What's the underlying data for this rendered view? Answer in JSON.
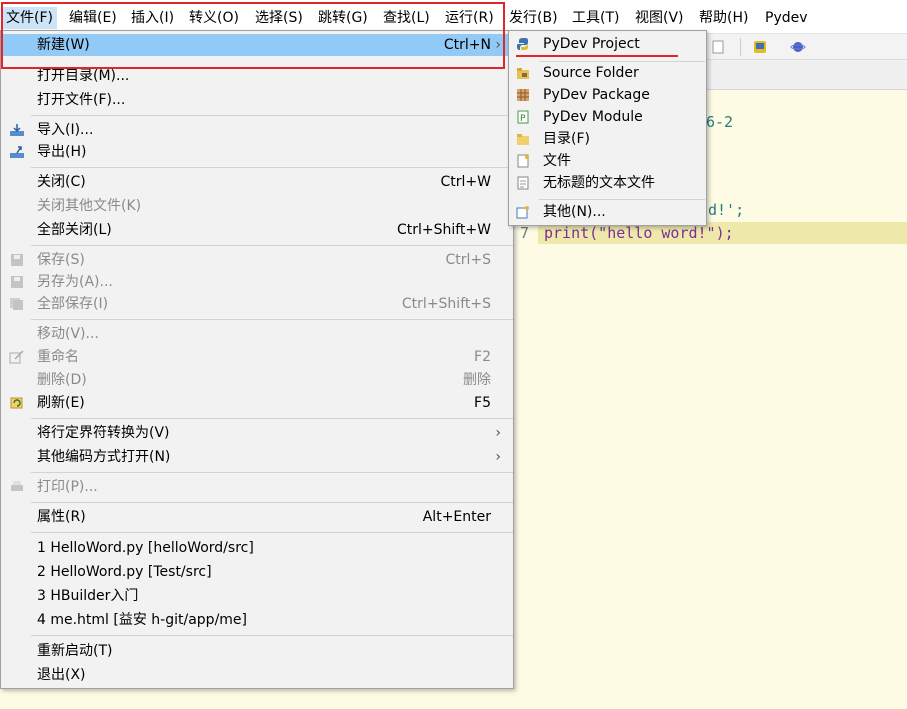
{
  "menubar": {
    "items": [
      "文件(F)",
      "编辑(E)",
      "插入(I)",
      "转义(O)",
      "选择(S)",
      "跳转(G)",
      "查找(L)",
      "运行(R)",
      "发行(B)",
      "工具(T)",
      "视图(V)",
      "帮助(H)",
      "Pydev"
    ]
  },
  "file_menu": {
    "new": {
      "label": "新建(W)",
      "accel": "Ctrl+N"
    },
    "open_dir": {
      "label": "打开目录(M)..."
    },
    "open_file": {
      "label": "打开文件(F)..."
    },
    "import": {
      "label": "导入(I)..."
    },
    "export": {
      "label": "导出(H)"
    },
    "close": {
      "label": "关闭(C)",
      "accel": "Ctrl+W"
    },
    "close_others": {
      "label": "关闭其他文件(K)"
    },
    "close_all": {
      "label": "全部关闭(L)",
      "accel": "Ctrl+Shift+W"
    },
    "save": {
      "label": "保存(S)",
      "accel": "Ctrl+S"
    },
    "save_as": {
      "label": "另存为(A)..."
    },
    "save_all": {
      "label": "全部保存(I)",
      "accel": "Ctrl+Shift+S"
    },
    "move": {
      "label": "移动(V)..."
    },
    "rename": {
      "label": "重命名",
      "accel": "F2"
    },
    "delete": {
      "label": "删除(D)",
      "accel": "删除"
    },
    "refresh": {
      "label": "刷新(E)",
      "accel": "F5"
    },
    "convert_eol": {
      "label": "将行定界符转换为(V)"
    },
    "open_encoding": {
      "label": "其他编码方式打开(N)"
    },
    "print": {
      "label": "打印(P)..."
    },
    "properties": {
      "label": "属性(R)",
      "accel": "Alt+Enter"
    },
    "recent": [
      "1 HelloWord.py  [helloWord/src]",
      "2 HelloWord.py  [Test/src]",
      "3 HBuilder入门",
      "4 me.html  [益安 h-git/app/me]"
    ],
    "restart": {
      "label": "重新启动(T)"
    },
    "exit": {
      "label": "退出(X)"
    },
    "submenu_arrow": "›"
  },
  "new_submenu": {
    "items": [
      "PyDev Project",
      "Source Folder",
      "PyDev Package",
      "PyDev Module",
      "目录(F)",
      "文件",
      "无标题的文本文件",
      "其他(N)..."
    ]
  },
  "editor": {
    "visible_fragment_1": "6-2",
    "visible_fragment_2": "d!';",
    "line_number": "7",
    "code_line": "print(\"hello word!\");"
  },
  "colors": {
    "highlight": "#91c9f7",
    "annotation_red": "#e0262a",
    "editor_bg": "#fdfbe4",
    "current_line": "#eee9ab"
  }
}
